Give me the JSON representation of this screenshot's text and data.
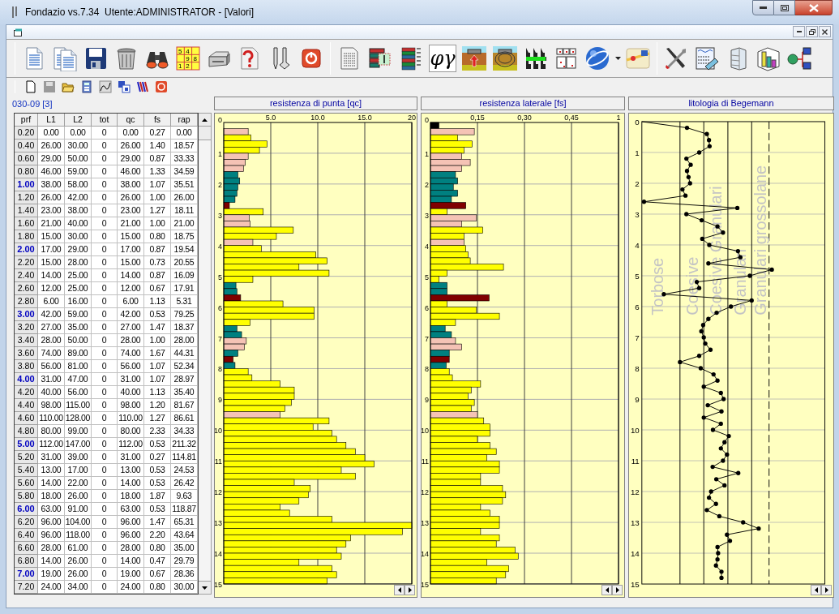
{
  "window": {
    "title": "Fondazio vs.7.34  Utente:ADMINISTRATOR - [Valori]"
  },
  "toolbar": {
    "grid_digits": [
      "5",
      "4",
      "9",
      "8",
      "1",
      "2"
    ],
    "symbol": "φγ"
  },
  "probe_label": "030-09 [3]",
  "table": {
    "columns": [
      "prf",
      "L1",
      "L2",
      "tot",
      "qc",
      "fs",
      "rap"
    ],
    "rows": [
      {
        "cells": [
          "0.20",
          "0.00",
          "0.00",
          "0",
          "0.00",
          "0.27",
          "0.00"
        ],
        "emphasized": false
      },
      {
        "cells": [
          "0.40",
          "26.00",
          "30.00",
          "0",
          "26.00",
          "1.40",
          "18.57"
        ],
        "emphasized": false
      },
      {
        "cells": [
          "0.60",
          "29.00",
          "50.00",
          "0",
          "29.00",
          "0.87",
          "33.33"
        ],
        "emphasized": false
      },
      {
        "cells": [
          "0.80",
          "46.00",
          "59.00",
          "0",
          "46.00",
          "1.33",
          "34.59"
        ],
        "emphasized": false
      },
      {
        "cells": [
          "1.00",
          "38.00",
          "58.00",
          "0",
          "38.00",
          "1.07",
          "35.51"
        ],
        "emphasized": true
      },
      {
        "cells": [
          "1.20",
          "26.00",
          "42.00",
          "0",
          "26.00",
          "1.00",
          "26.00"
        ],
        "emphasized": false
      },
      {
        "cells": [
          "1.40",
          "23.00",
          "38.00",
          "0",
          "23.00",
          "1.27",
          "18.11"
        ],
        "emphasized": false
      },
      {
        "cells": [
          "1.60",
          "21.00",
          "40.00",
          "0",
          "21.00",
          "1.00",
          "21.00"
        ],
        "emphasized": false
      },
      {
        "cells": [
          "1.80",
          "15.00",
          "30.00",
          "0",
          "15.00",
          "0.80",
          "18.75"
        ],
        "emphasized": false
      },
      {
        "cells": [
          "2.00",
          "17.00",
          "29.00",
          "0",
          "17.00",
          "0.87",
          "19.54"
        ],
        "emphasized": true
      },
      {
        "cells": [
          "2.20",
          "15.00",
          "28.00",
          "0",
          "15.00",
          "0.73",
          "20.55"
        ],
        "emphasized": false
      },
      {
        "cells": [
          "2.40",
          "14.00",
          "25.00",
          "0",
          "14.00",
          "0.87",
          "16.09"
        ],
        "emphasized": false
      },
      {
        "cells": [
          "2.60",
          "12.00",
          "25.00",
          "0",
          "12.00",
          "0.67",
          "17.91"
        ],
        "emphasized": false
      },
      {
        "cells": [
          "2.80",
          "6.00",
          "16.00",
          "0",
          "6.00",
          "1.13",
          "5.31"
        ],
        "emphasized": false
      },
      {
        "cells": [
          "3.00",
          "42.00",
          "59.00",
          "0",
          "42.00",
          "0.53",
          "79.25"
        ],
        "emphasized": true
      },
      {
        "cells": [
          "3.20",
          "27.00",
          "35.00",
          "0",
          "27.00",
          "1.47",
          "18.37"
        ],
        "emphasized": false
      },
      {
        "cells": [
          "3.40",
          "28.00",
          "50.00",
          "0",
          "28.00",
          "1.00",
          "28.00"
        ],
        "emphasized": false
      },
      {
        "cells": [
          "3.60",
          "74.00",
          "89.00",
          "0",
          "74.00",
          "1.67",
          "44.31"
        ],
        "emphasized": false
      },
      {
        "cells": [
          "3.80",
          "56.00",
          "81.00",
          "0",
          "56.00",
          "1.07",
          "52.34"
        ],
        "emphasized": false
      },
      {
        "cells": [
          "4.00",
          "31.00",
          "47.00",
          "0",
          "31.00",
          "1.07",
          "28.97"
        ],
        "emphasized": true
      },
      {
        "cells": [
          "4.20",
          "40.00",
          "56.00",
          "0",
          "40.00",
          "1.13",
          "35.40"
        ],
        "emphasized": false
      },
      {
        "cells": [
          "4.40",
          "98.00",
          "115.00",
          "0",
          "98.00",
          "1.20",
          "81.67"
        ],
        "emphasized": false
      },
      {
        "cells": [
          "4.60",
          "110.00",
          "128.00",
          "0",
          "110.00",
          "1.27",
          "86.61"
        ],
        "emphasized": false
      },
      {
        "cells": [
          "4.80",
          "80.00",
          "99.00",
          "0",
          "80.00",
          "2.33",
          "34.33"
        ],
        "emphasized": false
      },
      {
        "cells": [
          "5.00",
          "112.00",
          "147.00",
          "0",
          "112.00",
          "0.53",
          "211.32"
        ],
        "emphasized": true
      },
      {
        "cells": [
          "5.20",
          "31.00",
          "39.00",
          "0",
          "31.00",
          "0.27",
          "114.81"
        ],
        "emphasized": false
      },
      {
        "cells": [
          "5.40",
          "13.00",
          "17.00",
          "0",
          "13.00",
          "0.53",
          "24.53"
        ],
        "emphasized": false
      },
      {
        "cells": [
          "5.60",
          "14.00",
          "22.00",
          "0",
          "14.00",
          "0.53",
          "26.42"
        ],
        "emphasized": false
      },
      {
        "cells": [
          "5.80",
          "18.00",
          "26.00",
          "0",
          "18.00",
          "1.87",
          "9.63"
        ],
        "emphasized": false
      },
      {
        "cells": [
          "6.00",
          "63.00",
          "91.00",
          "0",
          "63.00",
          "0.53",
          "118.87"
        ],
        "emphasized": true
      },
      {
        "cells": [
          "6.20",
          "96.00",
          "104.00",
          "0",
          "96.00",
          "1.47",
          "65.31"
        ],
        "emphasized": false
      },
      {
        "cells": [
          "6.40",
          "96.00",
          "118.00",
          "0",
          "96.00",
          "2.20",
          "43.64"
        ],
        "emphasized": false
      },
      {
        "cells": [
          "6.60",
          "28.00",
          "61.00",
          "0",
          "28.00",
          "0.80",
          "35.00"
        ],
        "emphasized": false
      },
      {
        "cells": [
          "6.80",
          "14.00",
          "26.00",
          "0",
          "14.00",
          "0.47",
          "29.79"
        ],
        "emphasized": false
      },
      {
        "cells": [
          "7.00",
          "19.00",
          "26.00",
          "0",
          "19.00",
          "0.67",
          "28.36"
        ],
        "emphasized": true
      },
      {
        "cells": [
          "7.20",
          "24.00",
          "34.00",
          "0",
          "24.00",
          "0.80",
          "30.00"
        ],
        "emphasized": false
      }
    ]
  },
  "charts": [
    {
      "chart_data": {
        "type": "bar",
        "orientation": "horizontal",
        "title": "resistenza di punta [qc]",
        "grid": true,
        "x": [
          0.1,
          0.3,
          0.5,
          0.7,
          0.9,
          1.1,
          1.3,
          1.5,
          1.7,
          1.9,
          2.1,
          2.3,
          2.5,
          2.7,
          2.9,
          3.1,
          3.3,
          3.5,
          3.7,
          3.9,
          4.1,
          4.3,
          4.5,
          4.7,
          4.9,
          5.1,
          5.3,
          5.5,
          5.7,
          5.9,
          6.1,
          6.3,
          6.5,
          6.7,
          6.9,
          7.1,
          7.3,
          7.5,
          7.7,
          7.9,
          8.1,
          8.3,
          8.5,
          8.7,
          8.9,
          9.1,
          9.3,
          9.5,
          9.7,
          9.9,
          10.1,
          10.3,
          10.5,
          10.7,
          10.9,
          11.1,
          11.3,
          11.5,
          11.7,
          11.9,
          12.1,
          12.3,
          12.5,
          12.7,
          12.9,
          13.1,
          13.3,
          13.5,
          13.7,
          13.9,
          14.1,
          14.3,
          14.5,
          14.7,
          14.9
        ],
        "series": [
          {
            "values": [
              0,
              2.6,
              2.9,
              4.6,
              3.8,
              2.6,
              2.3,
              2.1,
              1.5,
              1.7,
              1.5,
              1.4,
              1.2,
              0.6,
              4.2,
              2.7,
              2.8,
              7.4,
              5.6,
              3.1,
              4.0,
              9.8,
              11.0,
              8.0,
              11.2,
              3.1,
              1.3,
              1.4,
              1.8,
              6.3,
              9.6,
              9.6,
              2.8,
              1.4,
              1.9,
              2.4,
              2.2,
              1.5,
              1.0,
              1.2,
              2.6,
              3.0,
              6.0,
              7.5,
              7.5,
              7.2,
              6.5,
              6.0,
              11.2,
              9.5,
              11.5,
              12.0,
              13.0,
              14.0,
              15.0,
              16.0,
              12.5,
              14.0,
              7.5,
              9.2,
              9.0,
              8.0,
              6.0,
              7.0,
              11.5,
              20.0,
              19.0,
              13.5,
              13.0,
              12.0,
              12.5,
              8.0,
              11.5,
              12.0,
              11.0
            ],
            "colors": [
              "#000000",
              "#f5c3b5",
              "#ffff00",
              "#ffff00",
              "#ffff00",
              "#f5c3b5",
              "#f5c3b5",
              "#f5c3b5",
              "#008080",
              "#008080",
              "#008080",
              "#008080",
              "#008080",
              "#800000",
              "#ffff00",
              "#f5c3b5",
              "#f5c3b5",
              "#ffff00",
              "#ffff00",
              "#f5c3b5",
              "#ffff00",
              "#ffff00",
              "#ffff00",
              "#ffff00",
              "#ffff00",
              "#ffff00",
              "#008080",
              "#008080",
              "#800000",
              "#ffff00",
              "#ffff00",
              "#ffff00",
              "#ffff00",
              "#008080",
              "#008080",
              "#f5c3b5",
              "#f5c3b5",
              "#008080",
              "#800000",
              "#008080",
              "#ffff00",
              "#ffff00",
              "#ffff00",
              "#ffff00",
              "#ffff00",
              "#ffff00",
              "#ffff00",
              "#f5c3b5",
              "#ffff00",
              "#ffff00",
              "#ffff00",
              "#ffff00",
              "#ffff00",
              "#ffff00",
              "#ffff00",
              "#ffff00",
              "#ffff00",
              "#ffff00",
              "#ffff00",
              "#ffff00",
              "#ffff00",
              "#ffff00",
              "#ffff00",
              "#ffff00",
              "#ffff00",
              "#ffff00",
              "#ffff00",
              "#ffff00",
              "#ffff00",
              "#ffff00",
              "#ffff00",
              "#ffff00",
              "#ffff00",
              "#ffff00",
              "#ffff00"
            ]
          }
        ],
        "xlim": [
          0,
          20
        ],
        "ylim": [
          15,
          0
        ],
        "xticks": [
          {
            "value": 5,
            "label": "5.0"
          },
          {
            "value": 10,
            "label": "10.0"
          },
          {
            "value": 15,
            "label": "15.0"
          },
          {
            "value": 20,
            "label": "20"
          }
        ],
        "yticks": [
          0,
          1,
          2,
          3,
          4,
          5,
          6,
          7,
          8,
          9,
          10,
          11,
          12,
          13,
          14,
          15
        ]
      }
    },
    {
      "chart_data": {
        "type": "bar",
        "orientation": "horizontal",
        "title": "resistenza laterale [fs]",
        "grid": true,
        "x": [
          0.1,
          0.3,
          0.5,
          0.7,
          0.9,
          1.1,
          1.3,
          1.5,
          1.7,
          1.9,
          2.1,
          2.3,
          2.5,
          2.7,
          2.9,
          3.1,
          3.3,
          3.5,
          3.7,
          3.9,
          4.1,
          4.3,
          4.5,
          4.7,
          4.9,
          5.1,
          5.3,
          5.5,
          5.7,
          5.9,
          6.1,
          6.3,
          6.5,
          6.7,
          6.9,
          7.1,
          7.3,
          7.5,
          7.7,
          7.9,
          8.1,
          8.3,
          8.5,
          8.7,
          8.9,
          9.1,
          9.3,
          9.5,
          9.7,
          9.9,
          10.1,
          10.3,
          10.5,
          10.7,
          10.9,
          11.1,
          11.3,
          11.5,
          11.7,
          11.9,
          12.1,
          12.3,
          12.5,
          12.7,
          12.9,
          13.1,
          13.3,
          13.5,
          13.7,
          13.9,
          14.1,
          14.3,
          14.5,
          14.7,
          14.9
        ],
        "series": [
          {
            "values": [
              0.027,
              0.14,
              0.087,
              0.133,
              0.107,
              0.1,
              0.127,
              0.1,
              0.08,
              0.087,
              0.073,
              0.087,
              0.067,
              0.113,
              0.053,
              0.147,
              0.1,
              0.167,
              0.107,
              0.107,
              0.113,
              0.12,
              0.127,
              0.233,
              0.053,
              0.027,
              0.053,
              0.053,
              0.187,
              0.053,
              0.147,
              0.22,
              0.08,
              0.047,
              0.067,
              0.08,
              0.1,
              0.06,
              0.06,
              0.05,
              0.06,
              0.07,
              0.16,
              0.13,
              0.12,
              0.14,
              0.13,
              0.15,
              0.17,
              0.19,
              0.19,
              0.15,
              0.19,
              0.21,
              0.18,
              0.22,
              0.22,
              0.16,
              0.16,
              0.23,
              0.24,
              0.23,
              0.16,
              0.19,
              0.22,
              0.22,
              0.16,
              0.22,
              0.21,
              0.27,
              0.28,
              0.18,
              0.25,
              0.24,
              0.21
            ],
            "colors": [
              "#000000",
              "#f5c3b5",
              "#ffff00",
              "#ffff00",
              "#ffff00",
              "#f5c3b5",
              "#f5c3b5",
              "#f5c3b5",
              "#008080",
              "#008080",
              "#008080",
              "#008080",
              "#008080",
              "#800000",
              "#ffff00",
              "#f5c3b5",
              "#f5c3b5",
              "#ffff00",
              "#ffff00",
              "#f5c3b5",
              "#ffff00",
              "#ffff00",
              "#ffff00",
              "#ffff00",
              "#ffff00",
              "#ffff00",
              "#008080",
              "#008080",
              "#800000",
              "#ffff00",
              "#ffff00",
              "#ffff00",
              "#ffff00",
              "#008080",
              "#008080",
              "#f5c3b5",
              "#f5c3b5",
              "#008080",
              "#800000",
              "#008080",
              "#ffff00",
              "#ffff00",
              "#ffff00",
              "#ffff00",
              "#ffff00",
              "#ffff00",
              "#ffff00",
              "#f5c3b5",
              "#ffff00",
              "#ffff00",
              "#ffff00",
              "#ffff00",
              "#ffff00",
              "#ffff00",
              "#ffff00",
              "#ffff00",
              "#ffff00",
              "#ffff00",
              "#ffff00",
              "#ffff00",
              "#ffff00",
              "#ffff00",
              "#ffff00",
              "#ffff00",
              "#ffff00",
              "#ffff00",
              "#ffff00",
              "#ffff00",
              "#ffff00",
              "#ffff00",
              "#ffff00",
              "#ffff00",
              "#ffff00",
              "#ffff00",
              "#ffff00"
            ]
          }
        ],
        "xlim": [
          0,
          0.6
        ],
        "ylim": [
          15,
          0
        ],
        "xticks": [
          {
            "value": 0.15,
            "label": "0,15"
          },
          {
            "value": 0.3,
            "label": "0,30"
          },
          {
            "value": 0.45,
            "label": "0,45"
          },
          {
            "value": 0.6,
            "label": "1"
          }
        ],
        "yticks": [
          0,
          1,
          2,
          3,
          4,
          5,
          6,
          7,
          8,
          9,
          10,
          11,
          12,
          13,
          14,
          15
        ]
      }
    }
  ],
  "lithology": {
    "title": "litologia di Begemann",
    "yticks": [
      "0",
      "1",
      "2",
      "3",
      "4",
      "5",
      "6",
      "7",
      "8",
      "9",
      "10",
      "11",
      "12",
      "13",
      "14",
      "15"
    ],
    "zones": [
      "Torbose",
      "Coesive",
      "Coesive Granulari",
      "Granulari",
      "Granulari grossolane"
    ]
  }
}
